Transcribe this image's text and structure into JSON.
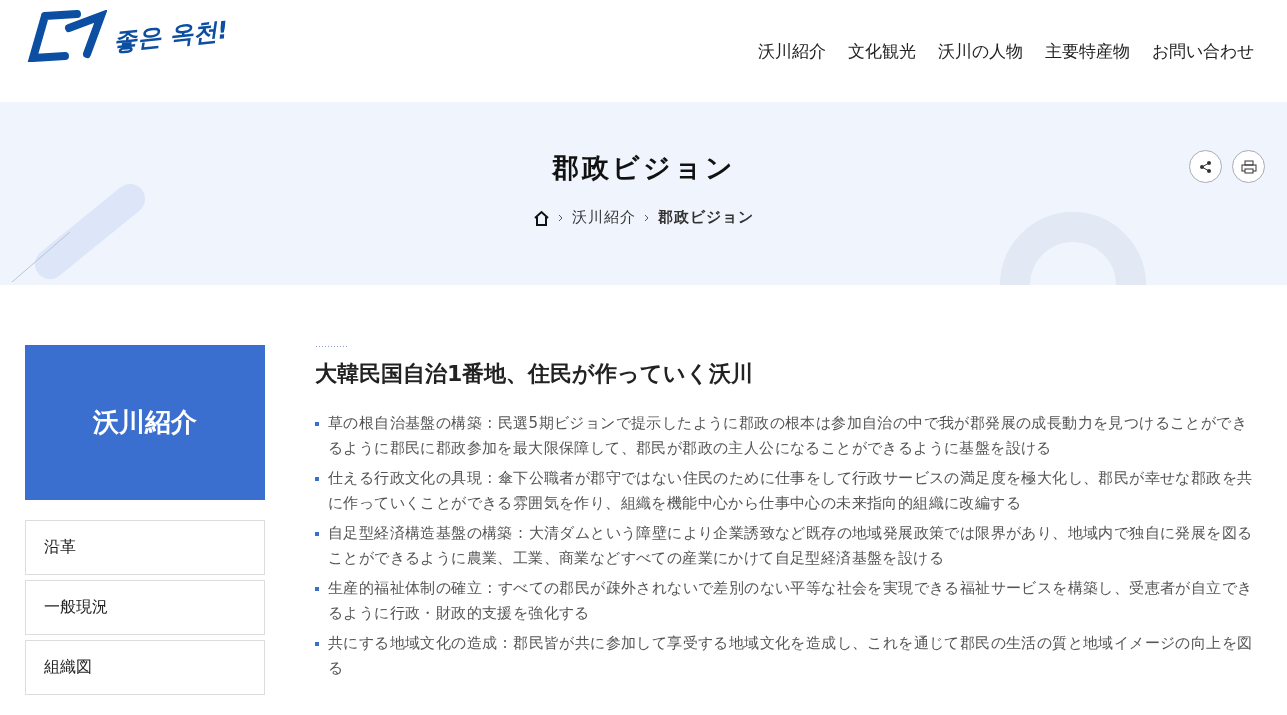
{
  "logo": {
    "text": "좋은 옥천!"
  },
  "nav": [
    "沃川紹介",
    "文化観光",
    "沃川の人物",
    "主要特産物",
    "お問い合わせ"
  ],
  "banner": {
    "title": "郡政ビジョン",
    "breadcrumb": [
      "沃川紹介",
      "郡政ビジョン"
    ]
  },
  "sidebar": {
    "title": "沃川紹介",
    "items": [
      {
        "label": "沿革",
        "selected": false
      },
      {
        "label": "一般現況",
        "selected": false
      },
      {
        "label": "組織図",
        "selected": false
      }
    ]
  },
  "content": {
    "heading": "大韓民国自治1番地、住民が作っていく沃川",
    "items": [
      "草の根自治基盤の構築 : 民選5期ビジョンで提示したように郡政の根本は参加自治の中で我が郡発展の成長動力を見つけることができるように郡民に郡政参加を最大限保障して、郡民が郡政の主人公になることができるように基盤を設ける",
      "仕える行政文化の具現 : 傘下公職者が郡守ではない住民のために仕事をして行政サービスの満足度を極大化し、郡民が幸せな郡政を共に作っていくことができる雰囲気を作り、組織を機能中心から仕事中心の未来指向的組織に改編する",
      "自足型経済構造基盤の構築 : 大清ダムという障壁により企業誘致など既存の地域発展政策では限界があり、地域内で独自に発展を図ることができるように農業、工業、商業などすべての産業にかけて自足型経済基盤を設ける",
      "生産的福祉体制の確立 : すべての郡民が疎外されないで差別のない平等な社会を実現できる福祉サービスを構築し、受恵者が自立できるように行政・財政的支援を強化する",
      "共にする地域文化の造成 : 郡民皆が共に参加して享受する地域文化を造成し、これを通じて郡民の生活の質と地域イメージの向上を図る"
    ]
  }
}
